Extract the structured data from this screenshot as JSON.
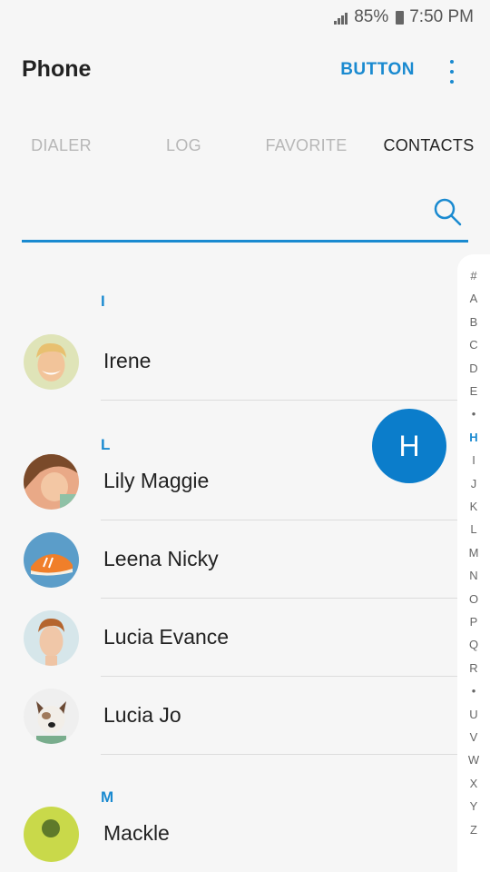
{
  "status": {
    "battery": "85%",
    "time": "7:50 PM"
  },
  "app": {
    "title": "Phone",
    "button_label": "BUTTON"
  },
  "tabs": [
    {
      "label": "DIALER",
      "active": false
    },
    {
      "label": "LOG",
      "active": false
    },
    {
      "label": "FAVORITE",
      "active": false
    },
    {
      "label": "CONTACTS",
      "active": true
    }
  ],
  "search": {
    "value": ""
  },
  "sections": [
    {
      "letter": "I",
      "contacts": [
        {
          "name": "Irene",
          "avatar": "face-blond-man"
        }
      ]
    },
    {
      "letter": "L",
      "contacts": [
        {
          "name": "Lily Maggie",
          "avatar": "face-girl"
        },
        {
          "name": "Leena Nicky",
          "avatar": "orange-sneaker"
        },
        {
          "name": "Lucia Evance",
          "avatar": "face-redhead-man"
        },
        {
          "name": "Lucia Jo",
          "avatar": "dog"
        }
      ]
    },
    {
      "letter": "M",
      "contacts": [
        {
          "name": "Mackle",
          "avatar": "green-plant"
        }
      ]
    }
  ],
  "fab_letter": "H",
  "index": [
    "#",
    "A",
    "B",
    "C",
    "D",
    "E",
    "•",
    "H",
    "I",
    "J",
    "K",
    "L",
    "M",
    "N",
    "O",
    "P",
    "Q",
    "R",
    "•",
    "U",
    "V",
    "W",
    "X",
    "Y",
    "Z"
  ],
  "index_active": "H",
  "colors": {
    "accent": "#1a8ad0",
    "fab": "#0b7dcb",
    "background": "#f6f6f6"
  }
}
